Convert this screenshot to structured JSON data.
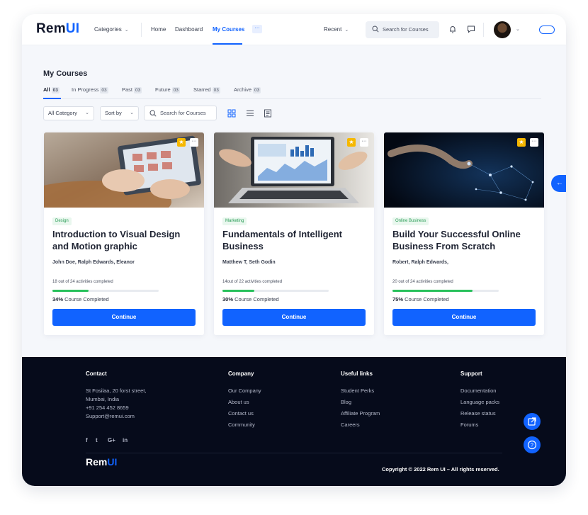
{
  "header": {
    "logo_main": "Rem",
    "logo_accent": "UI",
    "categories_label": "Categories",
    "nav": [
      "Home",
      "Dashboard",
      "My Courses"
    ],
    "more_label": "···",
    "recent_label": "Recent",
    "search_placeholder": "Search for Courses"
  },
  "page": {
    "title": "My Courses",
    "tabs": [
      {
        "label": "All",
        "count": "03"
      },
      {
        "label": "In Progress",
        "count": "03"
      },
      {
        "label": "Past",
        "count": "03"
      },
      {
        "label": "Future",
        "count": "03"
      },
      {
        "label": "Starred",
        "count": "03"
      },
      {
        "label": "Archive",
        "count": "03"
      }
    ],
    "filters": {
      "category": "All Category",
      "sort": "Sort by",
      "search_placeholder": "Search for Courses"
    }
  },
  "cards": [
    {
      "tag": "Design",
      "title": "Introduction to Visual Design and Motion graphic",
      "authors": "John Doe, Ralph Edwards, Eleanor",
      "progress_text": "18 out of 24 activities completed",
      "progress": 0.34,
      "pct_value": "34%",
      "pct_label": "Course Completed",
      "button": "Continue"
    },
    {
      "tag": "Marketing",
      "title": "Fundamentals of Intelligent Business",
      "authors": "Matthew T, Seth Godin",
      "progress_text": "14out of 22 activities completed",
      "progress": 0.3,
      "pct_value": "30%",
      "pct_label": "Course Completed",
      "button": "Continue"
    },
    {
      "tag": "Online Business",
      "title": "Build Your Successful Online Business From Scratch",
      "authors": "Robert, Ralph Edwards,",
      "progress_text": "20 out of 24 activities completed",
      "progress": 0.75,
      "pct_value": "75%",
      "pct_label": "Course Completed",
      "button": "Continue"
    }
  ],
  "footer": {
    "contact": {
      "heading": "Contact",
      "lines": [
        "St Fosilaa, 20 forst street,",
        "Mumbai, India",
        "+91 254 452 8659",
        "Support@remui.com"
      ]
    },
    "company": {
      "heading": "Company",
      "links": [
        "Our Company",
        "About us",
        "Contact us",
        "Community"
      ]
    },
    "useful": {
      "heading": "Useful links",
      "links": [
        "Student Perks",
        "Blog",
        "Affiliate Program",
        "Careers"
      ]
    },
    "support": {
      "heading": "Support",
      "links": [
        "Documentation",
        "Language packs",
        "Release status",
        "Forums"
      ]
    },
    "social": [
      "f",
      "t",
      "G+",
      "in"
    ],
    "logo_main": "Rem",
    "logo_accent": "UI",
    "copyright": "Copyright © 2022 Rem UI – All rights reserved."
  },
  "colors": {
    "accent": "#1163ff",
    "progress": "#29c15c",
    "footer_bg": "#060b1b",
    "star": "#f6b800"
  }
}
